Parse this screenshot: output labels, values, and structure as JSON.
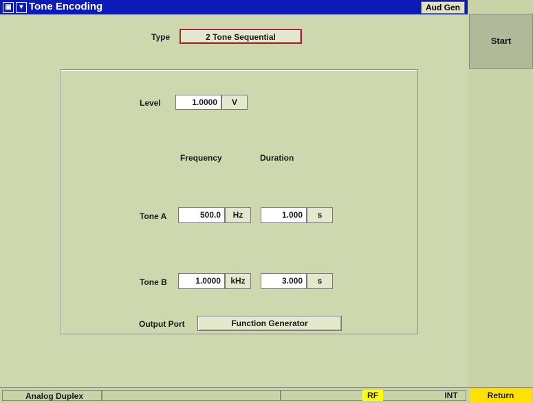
{
  "titlebar": {
    "title": "Tone Encoding",
    "window_icon": "restore-icon",
    "menu_icon": "dropdown-arrow-icon",
    "badge": "Aud Gen"
  },
  "type": {
    "label": "Type",
    "value": "2 Tone Sequential"
  },
  "level": {
    "label": "Level",
    "value": "1.0000",
    "unit": "V"
  },
  "columns": {
    "frequency": "Frequency",
    "duration": "Duration"
  },
  "tones": [
    {
      "label": "Tone A",
      "frequency": "500.0",
      "frequency_unit": "Hz",
      "duration": "1.000",
      "duration_unit": "s"
    },
    {
      "label": "Tone B",
      "frequency": "1.0000",
      "frequency_unit": "kHz",
      "duration": "3.000",
      "duration_unit": "s"
    }
  ],
  "output_port": {
    "label": "Output Port",
    "value": "Function Generator"
  },
  "side": {
    "start_label": "Start"
  },
  "statusbar": {
    "mode": "Analog Duplex",
    "rf": "RF",
    "int": "INT",
    "return_label": "Return"
  },
  "colors": {
    "titlebar": "#0c1ab8",
    "background": "#cdd8ae",
    "highlight": "#ffff00",
    "selected_border": "#b22222"
  }
}
